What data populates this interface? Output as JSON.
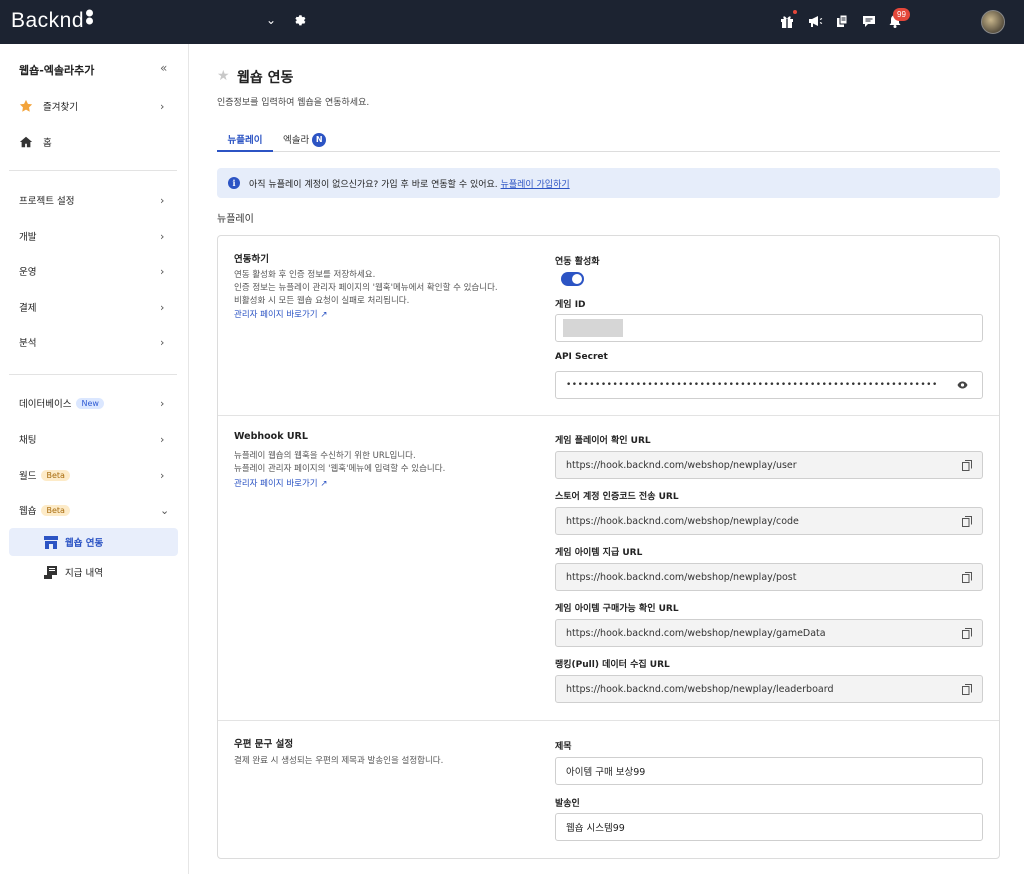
{
  "topbar": {
    "logo": "Backnd",
    "chevron": "⌄",
    "notification_count": "99",
    "icons": [
      "gift-icon",
      "megaphone-icon",
      "documents-icon",
      "chat-icon",
      "bell-icon"
    ]
  },
  "sidebar": {
    "title": "웹숍-엑솔라추가",
    "collapse": "«",
    "items": [
      {
        "label": "즐겨찾기",
        "icon": "star-icon"
      },
      {
        "label": "홈",
        "icon": "home-icon"
      },
      {
        "label": "프로젝트 설정"
      },
      {
        "label": "개발"
      },
      {
        "label": "운영"
      },
      {
        "label": "결제"
      },
      {
        "label": "분석"
      },
      {
        "label": "데이터베이스",
        "tag": "New"
      },
      {
        "label": "채팅"
      },
      {
        "label": "월드",
        "tag": "Beta"
      },
      {
        "label": "웹숍",
        "tag": "Beta"
      }
    ],
    "sub_items": [
      {
        "label": "웹숍 연동",
        "icon": "store-icon",
        "active": true
      },
      {
        "label": "지급 내역",
        "icon": "receipt-icon"
      }
    ]
  },
  "main": {
    "title": "웹숍 연동",
    "description": "인증정보를 입력하여 웹숍을 연동하세요.",
    "tabs": [
      {
        "label": "뉴플레이"
      },
      {
        "label": "엑솔라",
        "badge": "N"
      }
    ],
    "info": {
      "text": "아직 뉴플레이 계정이 없으신가요? 가입 후 바로 연동할 수 있어요.",
      "link": "뉴플레이 가입하기"
    },
    "section_title": "뉴플레이",
    "connect": {
      "title": "연동하기",
      "desc1": "연동 활성화 후 인증 정보를 저장하세요.",
      "desc2": "인증 정보는 뉴플레이 관리자 페이지의 '웹훅'메뉴에서 확인할 수 있습니다.",
      "desc3": "비활성화 시 모든 웹숍 요청이 실패로 처리됩니다.",
      "link": "관리자 페이지 바로가기",
      "toggle_label": "연동 활성화",
      "toggle_on": true,
      "game_id_label": "게임 ID",
      "api_secret_label": "API Secret",
      "api_secret_value": "••••••••••••••••••••••••••••••••••••••••••••••••••••••••••••••••"
    },
    "webhook": {
      "title": "Webhook URL",
      "desc1": "뉴플레이 웹숍의 웹훅을 수신하기 위한 URL입니다.",
      "desc2": "뉴플레이 관리자 페이지의 '웹훅'메뉴에 입력할 수 있습니다.",
      "link": "관리자 페이지 바로가기",
      "fields": [
        {
          "label": "게임 플레이어 확인 URL",
          "value": "https://hook.backnd.com/webshop/newplay/user"
        },
        {
          "label": "스토어 계정 인증코드 전송 URL",
          "value": "https://hook.backnd.com/webshop/newplay/code"
        },
        {
          "label": "게임 아이템 지급 URL",
          "value": "https://hook.backnd.com/webshop/newplay/post"
        },
        {
          "label": "게임 아이템 구매가능 확인 URL",
          "value": "https://hook.backnd.com/webshop/newplay/gameData"
        },
        {
          "label": "랭킹(Pull) 데이터 수집 URL",
          "value": "https://hook.backnd.com/webshop/newplay/leaderboard"
        }
      ]
    },
    "mail": {
      "title": "우편 문구 설정",
      "desc": "결제 완료 시 생성되는 우편의 제목과 발송인을 설정합니다.",
      "subject_label": "제목",
      "subject_value": "아이템 구매 보상99",
      "sender_label": "발송인",
      "sender_value": "웹숍 시스템99"
    }
  }
}
